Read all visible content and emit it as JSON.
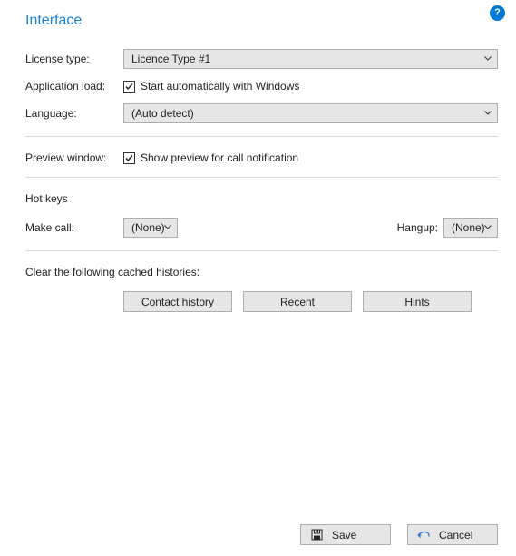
{
  "title": "Interface",
  "fields": {
    "license_type": {
      "label": "License type:",
      "value": "Licence Type #1"
    },
    "application_load": {
      "label": "Application load:",
      "checkbox_label": "Start automatically with Windows",
      "checked": true
    },
    "language": {
      "label": "Language:",
      "value": "(Auto detect)"
    },
    "preview_window": {
      "label": "Preview window:",
      "checkbox_label": "Show preview for call notification",
      "checked": true
    }
  },
  "hotkeys": {
    "heading": "Hot keys",
    "make_call": {
      "label": "Make call:",
      "value": "(None)"
    },
    "hangup": {
      "label": "Hangup:",
      "value": "(None)"
    }
  },
  "clear": {
    "heading": "Clear the following cached histories:",
    "buttons": [
      "Contact history",
      "Recent",
      "Hints"
    ]
  },
  "footer": {
    "save": "Save",
    "cancel": "Cancel"
  }
}
